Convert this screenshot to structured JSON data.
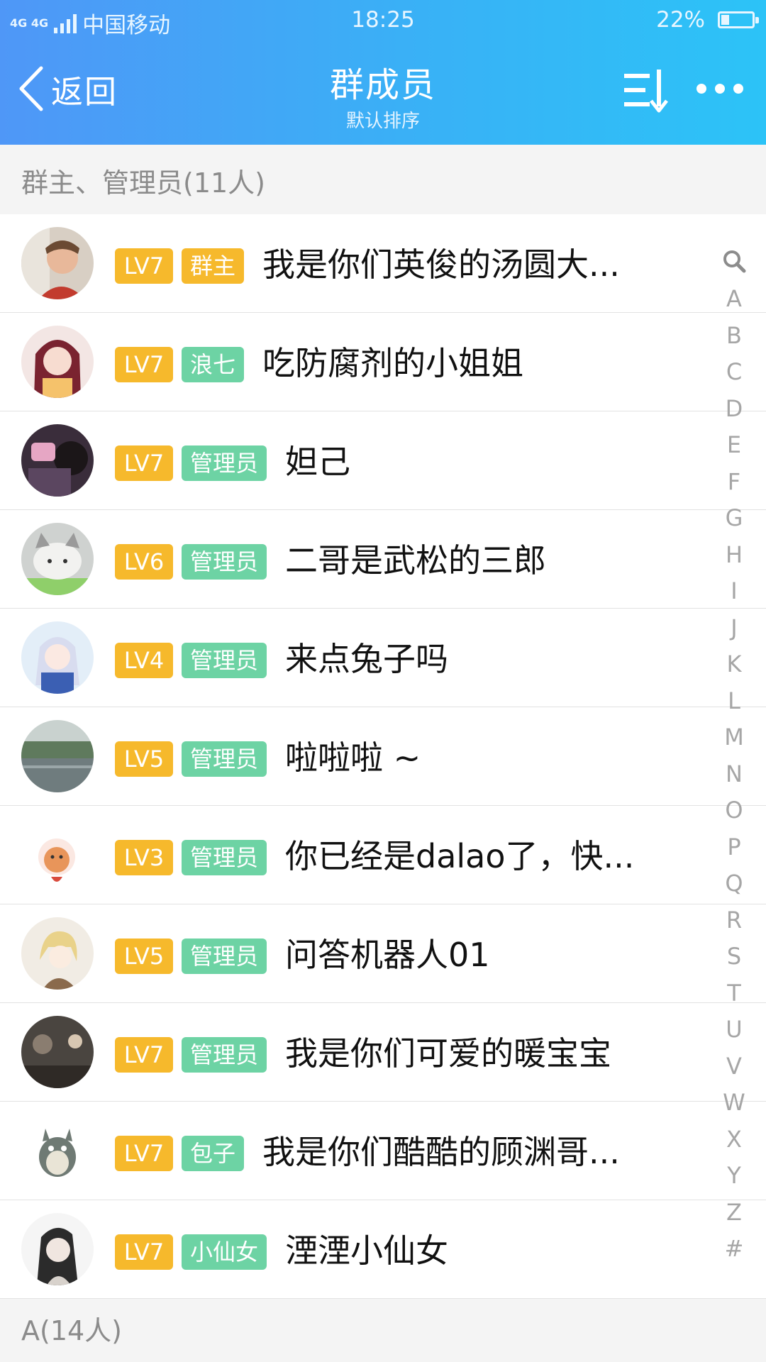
{
  "status_bar": {
    "network": "4G 4G",
    "carrier": "中国移动",
    "time": "18:25",
    "battery": "22%",
    "battery_level": 0.22
  },
  "header": {
    "back_label": "返回",
    "title": "群成员",
    "subtitle": "默认排序",
    "sort_icon": "sort-icon",
    "more_icon": "more-icon"
  },
  "sections": [
    {
      "title": "群主、管理员(11人)"
    },
    {
      "title": "A(14人)"
    }
  ],
  "members": [
    {
      "level": "LV7",
      "role": "群主",
      "name": "我是你们英俊的汤圆大..."
    },
    {
      "level": "LV7",
      "role": "浪七",
      "name": "吃防腐剂的小姐姐"
    },
    {
      "level": "LV7",
      "role": "管理员",
      "name": "妲己"
    },
    {
      "level": "LV6",
      "role": "管理员",
      "name": "二哥是武松的三郎"
    },
    {
      "level": "LV4",
      "role": "管理员",
      "name": "来点兔子吗"
    },
    {
      "level": "LV5",
      "role": "管理员",
      "name": "啦啦啦 ~"
    },
    {
      "level": "LV3",
      "role": "管理员",
      "name": "你已经是dalao了，快..."
    },
    {
      "level": "LV5",
      "role": "管理员",
      "name": "问答机器人01"
    },
    {
      "level": "LV7",
      "role": "管理员",
      "name": "我是你们可爱的暖宝宝"
    },
    {
      "level": "LV7",
      "role": "包子",
      "name": "我是你们酷酷的顾渊哥..."
    },
    {
      "level": "LV7",
      "role": "小仙女",
      "name": "湮湮小仙女"
    }
  ],
  "index_bar": {
    "search_icon": "search-icon",
    "letters": [
      "A",
      "B",
      "C",
      "D",
      "E",
      "F",
      "G",
      "H",
      "I",
      "J",
      "K",
      "L",
      "M",
      "N",
      "O",
      "P",
      "Q",
      "R",
      "S",
      "T",
      "U",
      "V",
      "W",
      "X",
      "Y",
      "Z",
      "#"
    ]
  },
  "colors": {
    "header_start": "#4f97f7",
    "header_end": "#2cc3f7",
    "level_badge": "#f6b92c",
    "role_badge": "#6dd3a4",
    "section_bg": "#f4f4f4"
  }
}
